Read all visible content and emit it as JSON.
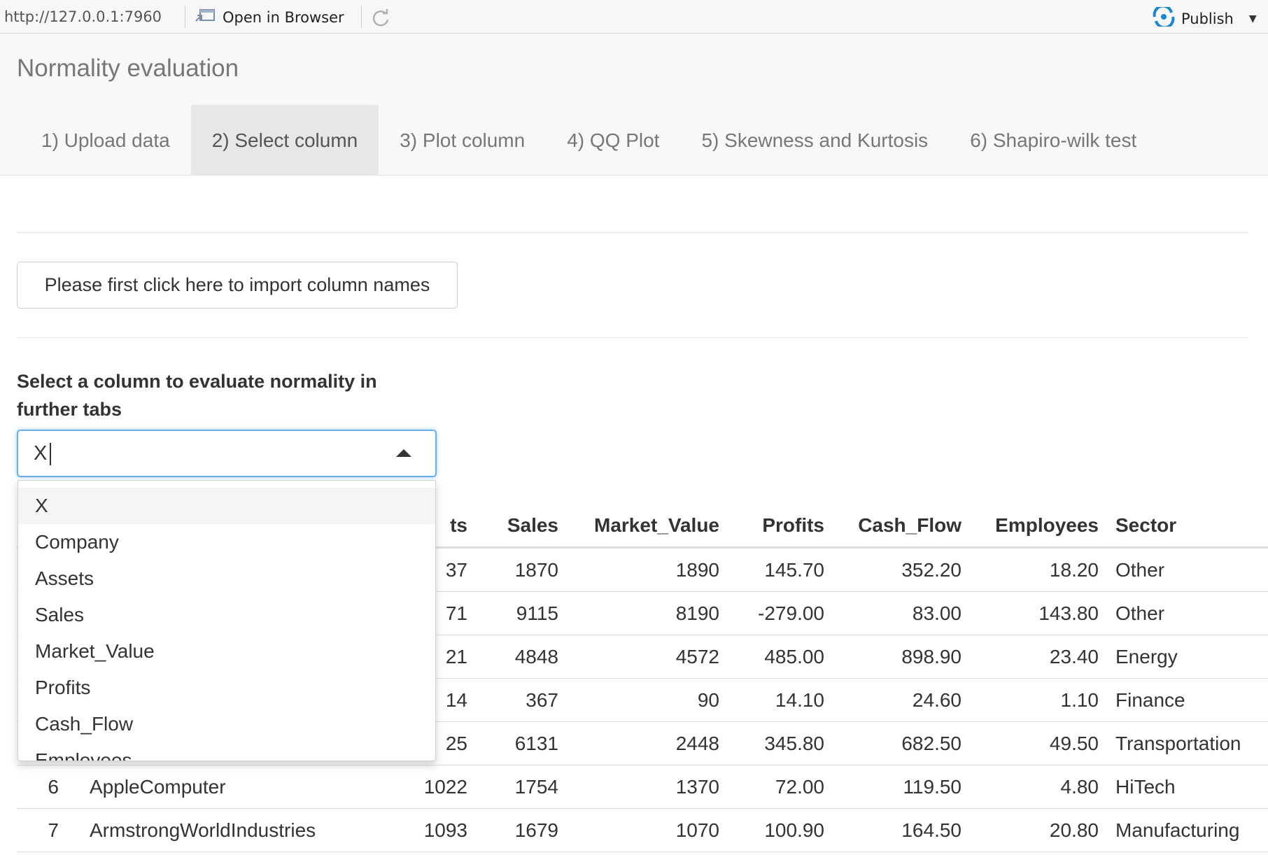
{
  "topbar": {
    "url": "http://127.0.0.1:7960",
    "open_in_browser": "Open in Browser",
    "publish": "Publish"
  },
  "navbar": {
    "title": "Normality evaluation",
    "tabs": [
      {
        "label": "1) Upload data"
      },
      {
        "label": "2) Select column"
      },
      {
        "label": "3) Plot column"
      },
      {
        "label": "4) QQ Plot"
      },
      {
        "label": "5) Skewness and Kurtosis"
      },
      {
        "label": "6) Shapiro-wilk test"
      }
    ]
  },
  "main": {
    "import_button": "Please first click here to import column names",
    "select_label": "Select a column to evaluate normality in further tabs",
    "select_value": "X",
    "dropdown_options": [
      "X",
      "Company",
      "Assets",
      "Sales",
      "Market_Value",
      "Profits",
      "Cash_Flow",
      "Employees"
    ]
  },
  "table": {
    "headers": [
      "",
      "",
      "Assets",
      "Sales",
      "Market_Value",
      "Profits",
      "Cash_Flow",
      "Employees",
      "Sector"
    ],
    "visible_header_fragment": "ts",
    "rows": [
      {
        "idx": "",
        "company": "",
        "assets": "37",
        "sales": "1870",
        "market_value": "1890",
        "profits": "145.70",
        "cash_flow": "352.20",
        "employees": "18.20",
        "sector": "Other"
      },
      {
        "idx": "",
        "company": "",
        "assets": "71",
        "sales": "9115",
        "market_value": "8190",
        "profits": "-279.00",
        "cash_flow": "83.00",
        "employees": "143.80",
        "sector": "Other"
      },
      {
        "idx": "",
        "company": "",
        "assets": "21",
        "sales": "4848",
        "market_value": "4572",
        "profits": "485.00",
        "cash_flow": "898.90",
        "employees": "23.40",
        "sector": "Energy"
      },
      {
        "idx": "",
        "company": "",
        "assets": "14",
        "sales": "367",
        "market_value": "90",
        "profits": "14.10",
        "cash_flow": "24.60",
        "employees": "1.10",
        "sector": "Finance"
      },
      {
        "idx": "",
        "company": "",
        "assets": "25",
        "sales": "6131",
        "market_value": "2448",
        "profits": "345.80",
        "cash_flow": "682.50",
        "employees": "49.50",
        "sector": "Transportation"
      },
      {
        "idx": "6",
        "company": "AppleComputer",
        "assets": "1022",
        "sales": "1754",
        "market_value": "1370",
        "profits": "72.00",
        "cash_flow": "119.50",
        "employees": "4.80",
        "sector": "HiTech"
      },
      {
        "idx": "7",
        "company": "ArmstrongWorldIndustries",
        "assets": "1093",
        "sales": "1679",
        "market_value": "1070",
        "profits": "100.90",
        "cash_flow": "164.50",
        "employees": "20.80",
        "sector": "Manufacturing"
      }
    ]
  },
  "colors": {
    "publish_icon": "#1a87d0",
    "focus_border": "#66afe9",
    "active_tab_bg": "#e7e7e7"
  }
}
